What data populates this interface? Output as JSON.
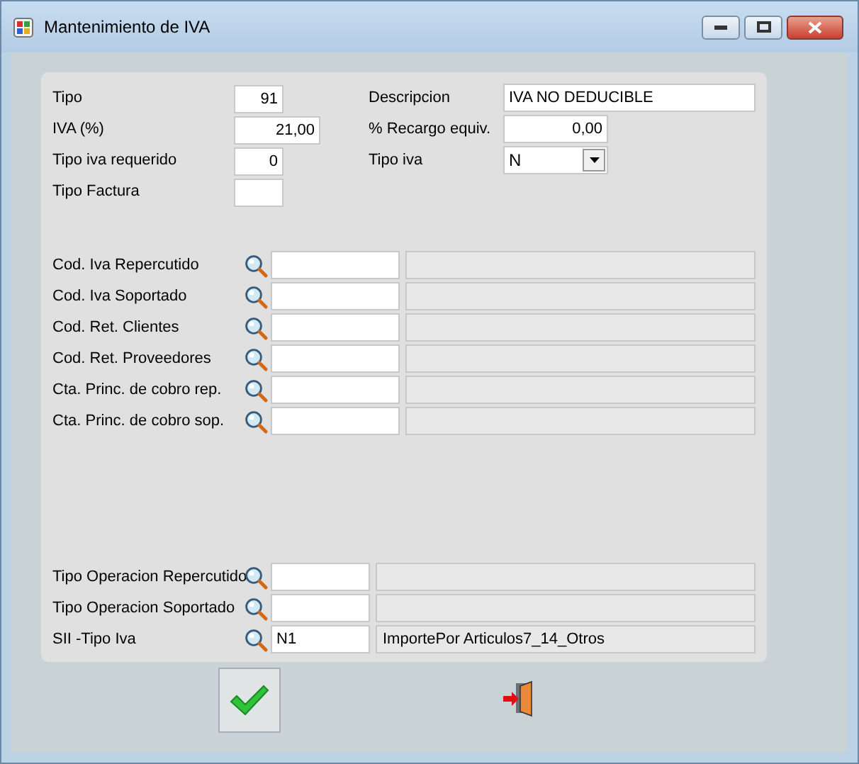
{
  "window": {
    "title": "Mantenimiento de IVA"
  },
  "top_rows": [
    {
      "left": {
        "label": "Tipo",
        "value": "91"
      },
      "right": {
        "kind": "text",
        "label": "Descripcion",
        "value": "IVA NO DEDUCIBLE"
      }
    },
    {
      "left": {
        "label": "IVA (%)",
        "value": "21,00"
      },
      "right": {
        "kind": "text",
        "label": "% Recargo equiv.",
        "value": "0,00"
      }
    },
    {
      "left": {
        "label": "Tipo iva requerido",
        "value": "0"
      },
      "right": {
        "kind": "select",
        "label": "Tipo iva",
        "value": "N"
      }
    },
    {
      "left": {
        "label": "Tipo Factura"
      }
    }
  ],
  "lookups": [
    {
      "label": "Cod. Iva Repercutido"
    },
    {
      "label": "Cod. Iva Soportado"
    },
    {
      "label": "Cod. Ret. Clientes"
    },
    {
      "label": "Cod. Ret. Proveedores"
    },
    {
      "label": "Cta. Princ. de cobro  rep."
    },
    {
      "label": "Cta. Princ. de cobro  sop."
    }
  ],
  "operation_lookups": [
    {
      "label": "Tipo Operacion Repercutido"
    },
    {
      "label": "Tipo Operacion Soportado"
    },
    {
      "label": "SII -Tipo Iva",
      "code": "N1",
      "description": "ImportePor Articulos7_14_Otros"
    }
  ]
}
